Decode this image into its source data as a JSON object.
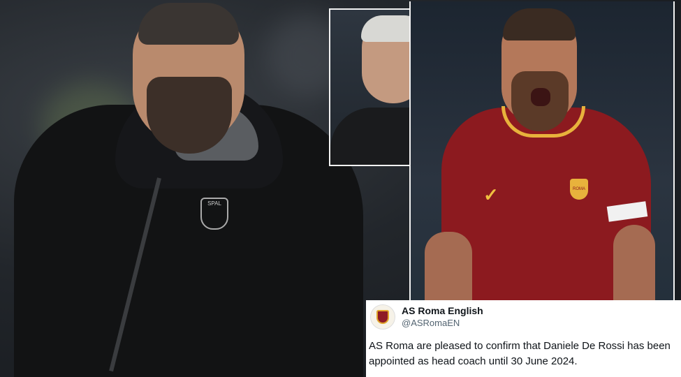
{
  "tweet": {
    "account_name": "AS Roma English",
    "handle": "@ASRomaEN",
    "text_line1": "AS Roma are pleased to confirm that Daniele De Rossi has been",
    "text_line2": "appointed as head coach until 30 June 2024."
  },
  "left_photo": {
    "badge_text": "SPAL"
  },
  "right_photo": {
    "crest_text": "ROMA"
  },
  "icons": {
    "avatar": "as-roma-crest-icon",
    "kit_logo": "swoosh-icon"
  },
  "colors": {
    "roma_red": "#8c1a1f",
    "roma_gold": "#e8b23c",
    "tweet_bg": "#ffffff",
    "handle_gray": "#536471"
  }
}
